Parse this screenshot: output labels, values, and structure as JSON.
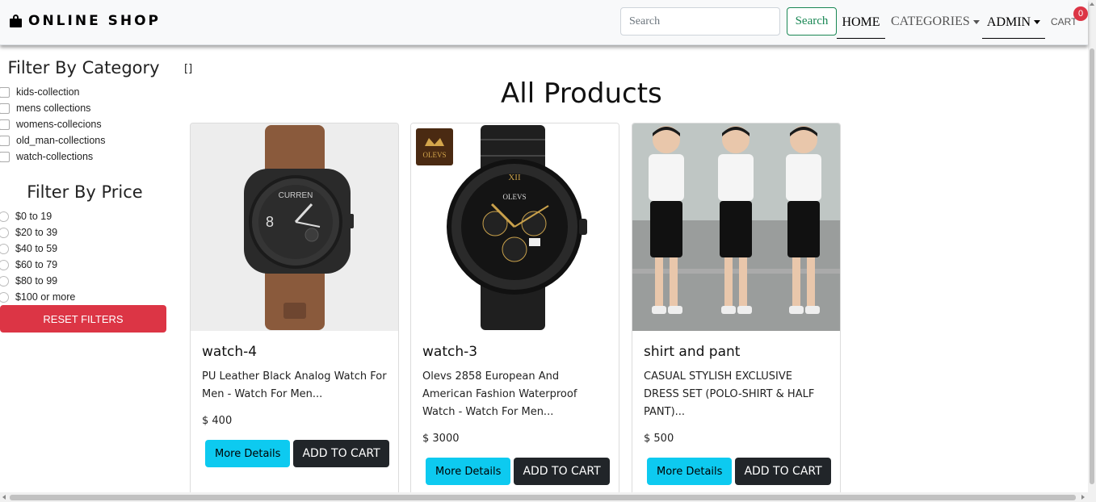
{
  "navbar": {
    "brand": "ONLINE SHOP",
    "search_placeholder": "Search",
    "search_button": "Search",
    "links": {
      "home": "HOME",
      "categories": "CATEGORIES",
      "admin": "ADMIN",
      "cart": "CART"
    },
    "cart_count": "0"
  },
  "sidebar": {
    "category_title": "Filter By Category",
    "categories": [
      "kids-collection",
      "mens collections",
      "womens-collecions",
      "old_man-collections",
      "watch-collections"
    ],
    "price_title": "Filter By Price",
    "prices": [
      "$0 to 19",
      "$20 to 39",
      "$40 to 59",
      "$60 to 79",
      "$80 to 99",
      "$100 or more"
    ],
    "reset_label": "RESET FILTERS",
    "toggle_glyph": "[]"
  },
  "main": {
    "title": "All Products",
    "products": [
      {
        "name": "watch-4",
        "description": "PU Leather Black Analog Watch For Men - Watch For Men...",
        "price": "$ 400",
        "details_label": "More Details",
        "cart_label": "ADD TO CART",
        "image": "brown-leather-watch"
      },
      {
        "name": "watch-3",
        "description": "Olevs 2858 European And American Fashion Waterproof Watch - Watch For Men...",
        "price": "$ 3000",
        "details_label": "More Details",
        "cart_label": "ADD TO CART",
        "image": "black-steel-watch",
        "image_logo": "OLEVS"
      },
      {
        "name": "shirt and pant",
        "description": "CASUAL STYLISH EXCLUSIVE DRESS SET (POLO-SHIRT & HALF PANT)...",
        "price": "$ 500",
        "details_label": "More Details",
        "cart_label": "ADD TO CART",
        "image": "kids-outfit-photo"
      }
    ]
  },
  "colors": {
    "danger": "#dc3545",
    "info": "#0dcaf0",
    "dark": "#212529",
    "success": "#198754"
  }
}
